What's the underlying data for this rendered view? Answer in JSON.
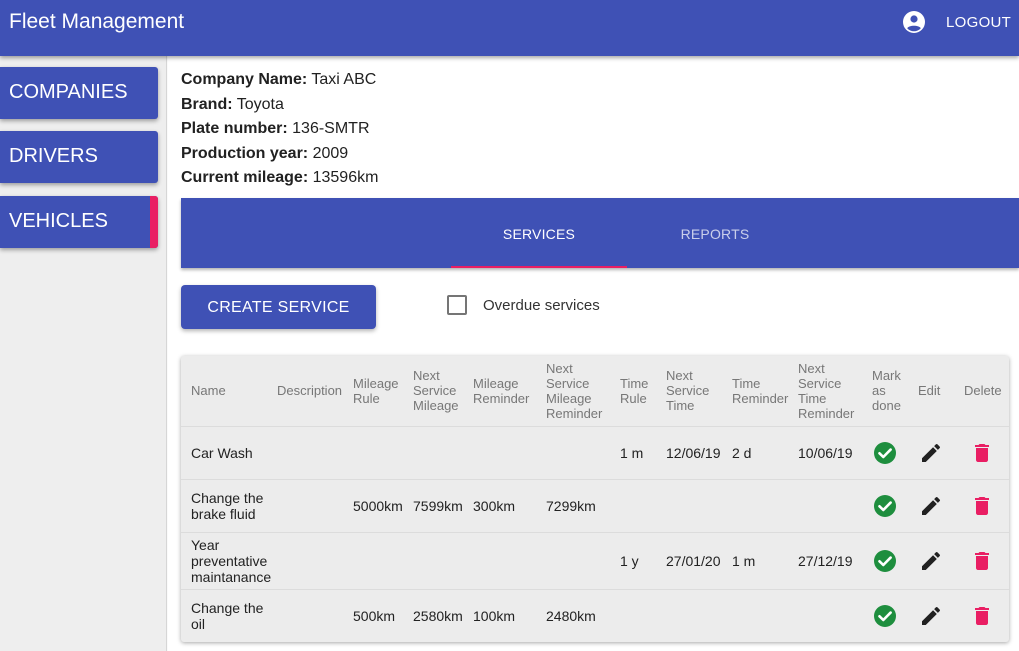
{
  "app": {
    "title": "Fleet Management",
    "logout_label": "LOGOUT",
    "account_icon": "account-circle-icon"
  },
  "sidebar": {
    "items": [
      {
        "label": "COMPANIES",
        "active": false
      },
      {
        "label": "DRIVERS",
        "active": false
      },
      {
        "label": "VEHICLES",
        "active": true
      }
    ]
  },
  "vehicle": {
    "company_label": "Company Name:",
    "company": "Taxi ABC",
    "brand_label": "Brand:",
    "brand": "Toyota",
    "plate_label": "Plate number:",
    "plate": "136-SMTR",
    "year_label": "Production year:",
    "year": "2009",
    "mileage_label": "Current mileage:",
    "mileage": "13596km"
  },
  "tabs": [
    {
      "label": "SERVICES",
      "active": true
    },
    {
      "label": "REPORTS",
      "active": false
    }
  ],
  "actions": {
    "create_label": "CREATE SERVICE",
    "overdue_label": "Overdue services",
    "overdue_checked": false
  },
  "table": {
    "headers": [
      "Name",
      "Description",
      "Mileage Rule",
      "Next Service Mileage",
      "Mileage Reminder",
      "Next Service Mileage Reminder",
      "Time Rule",
      "Next Service Time",
      "Time Reminder",
      "Next Service Time Reminder",
      "Mark as done",
      "Edit",
      "Delete"
    ],
    "rows": [
      {
        "name": "Car Wash",
        "description": "",
        "mileage_rule": "",
        "next_mileage": "",
        "mileage_reminder": "",
        "next_mileage_reminder": "",
        "time_rule": "1 m",
        "next_time": "12/06/19",
        "time_reminder": "2 d",
        "next_time_reminder": "10/06/19"
      },
      {
        "name": "Change the brake fluid",
        "description": "",
        "mileage_rule": "5000km",
        "next_mileage": "7599km",
        "mileage_reminder": "300km",
        "next_mileage_reminder": "7299km",
        "time_rule": "",
        "next_time": "",
        "time_reminder": "",
        "next_time_reminder": ""
      },
      {
        "name": "Year preventative maintanance",
        "description": "",
        "mileage_rule": "",
        "next_mileage": "",
        "mileage_reminder": "",
        "next_mileage_reminder": "",
        "time_rule": "1 y",
        "next_time": "27/01/20",
        "time_reminder": "1 m",
        "next_time_reminder": "27/12/19"
      },
      {
        "name": "Change the oil",
        "description": "",
        "mileage_rule": "500km",
        "next_mileage": "2580km",
        "mileage_reminder": "100km",
        "next_mileage_reminder": "2480km",
        "time_rule": "",
        "next_time": "",
        "time_reminder": "",
        "next_time_reminder": ""
      }
    ],
    "row_icons": {
      "done": "check-circle-icon",
      "edit": "pencil-icon",
      "delete": "trash-icon"
    }
  },
  "colors": {
    "primary": "#3f51b5",
    "accent": "#e91e63",
    "done": "#1e8e3e",
    "delete": "#e91e63"
  }
}
